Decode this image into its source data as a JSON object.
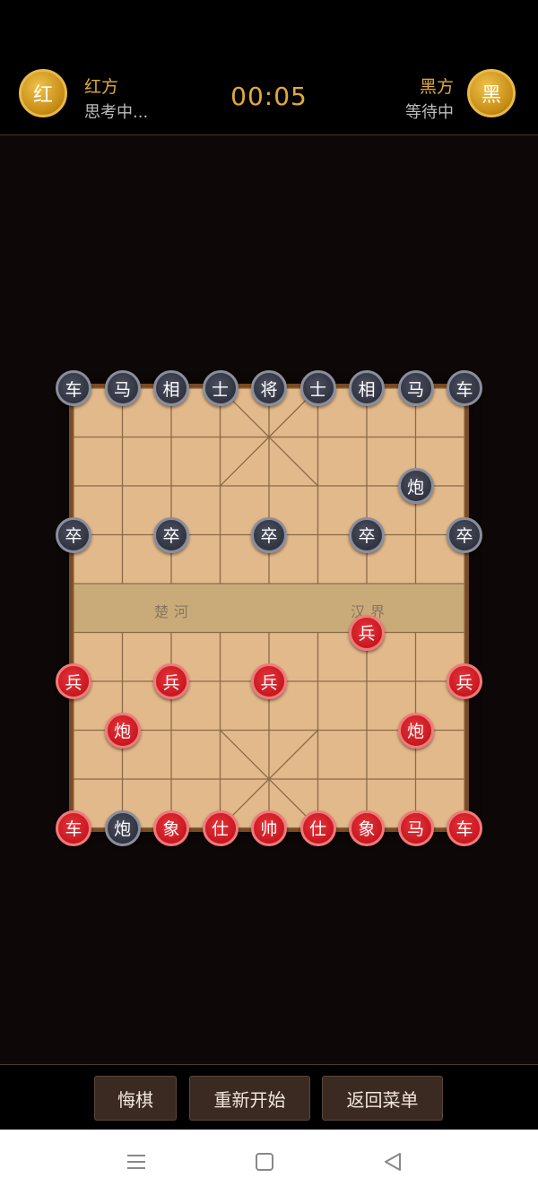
{
  "header": {
    "red_player": {
      "avatar_char": "红",
      "name": "红方",
      "status": "思考中..."
    },
    "black_player": {
      "avatar_char": "黑",
      "name": "黑方",
      "status": "等待中"
    },
    "timer": "00:05"
  },
  "board": {
    "river_left": "楚河",
    "river_right": "汉界",
    "pieces": [
      {
        "char": "车",
        "side": "black",
        "file": 0,
        "rank": 0
      },
      {
        "char": "马",
        "side": "black",
        "file": 1,
        "rank": 0
      },
      {
        "char": "相",
        "side": "black",
        "file": 2,
        "rank": 0
      },
      {
        "char": "士",
        "side": "black",
        "file": 3,
        "rank": 0
      },
      {
        "char": "将",
        "side": "black",
        "file": 4,
        "rank": 0
      },
      {
        "char": "士",
        "side": "black",
        "file": 5,
        "rank": 0
      },
      {
        "char": "相",
        "side": "black",
        "file": 6,
        "rank": 0
      },
      {
        "char": "马",
        "side": "black",
        "file": 7,
        "rank": 0
      },
      {
        "char": "车",
        "side": "black",
        "file": 8,
        "rank": 0
      },
      {
        "char": "炮",
        "side": "black",
        "file": 7,
        "rank": 2
      },
      {
        "char": "卒",
        "side": "black",
        "file": 0,
        "rank": 3
      },
      {
        "char": "卒",
        "side": "black",
        "file": 2,
        "rank": 3
      },
      {
        "char": "卒",
        "side": "black",
        "file": 4,
        "rank": 3
      },
      {
        "char": "卒",
        "side": "black",
        "file": 6,
        "rank": 3
      },
      {
        "char": "卒",
        "side": "black",
        "file": 8,
        "rank": 3
      },
      {
        "char": "兵",
        "side": "red",
        "file": 6,
        "rank": 5
      },
      {
        "char": "兵",
        "side": "red",
        "file": 0,
        "rank": 6
      },
      {
        "char": "兵",
        "side": "red",
        "file": 2,
        "rank": 6
      },
      {
        "char": "兵",
        "side": "red",
        "file": 4,
        "rank": 6
      },
      {
        "char": "兵",
        "side": "red",
        "file": 8,
        "rank": 6
      },
      {
        "char": "炮",
        "side": "red",
        "file": 1,
        "rank": 7
      },
      {
        "char": "炮",
        "side": "red",
        "file": 7,
        "rank": 7
      },
      {
        "char": "车",
        "side": "red",
        "file": 0,
        "rank": 9
      },
      {
        "char": "炮",
        "side": "black",
        "file": 1,
        "rank": 9
      },
      {
        "char": "象",
        "side": "red",
        "file": 2,
        "rank": 9
      },
      {
        "char": "仕",
        "side": "red",
        "file": 3,
        "rank": 9
      },
      {
        "char": "帅",
        "side": "red",
        "file": 4,
        "rank": 9
      },
      {
        "char": "仕",
        "side": "red",
        "file": 5,
        "rank": 9
      },
      {
        "char": "象",
        "side": "red",
        "file": 6,
        "rank": 9
      },
      {
        "char": "马",
        "side": "red",
        "file": 7,
        "rank": 9
      },
      {
        "char": "车",
        "side": "red",
        "file": 8,
        "rank": 9
      }
    ]
  },
  "controls": {
    "undo_label": "悔棋",
    "restart_label": "重新开始",
    "menu_label": "返回菜单"
  },
  "navbar": {
    "icons": [
      "menu-icon",
      "home-icon",
      "back-icon"
    ]
  },
  "colors": {
    "accent": "#e2aa3c",
    "red_piece": "#c4161e",
    "black_piece": "#2e313d",
    "board": "#e2b98b",
    "line": "#8c6a48"
  }
}
